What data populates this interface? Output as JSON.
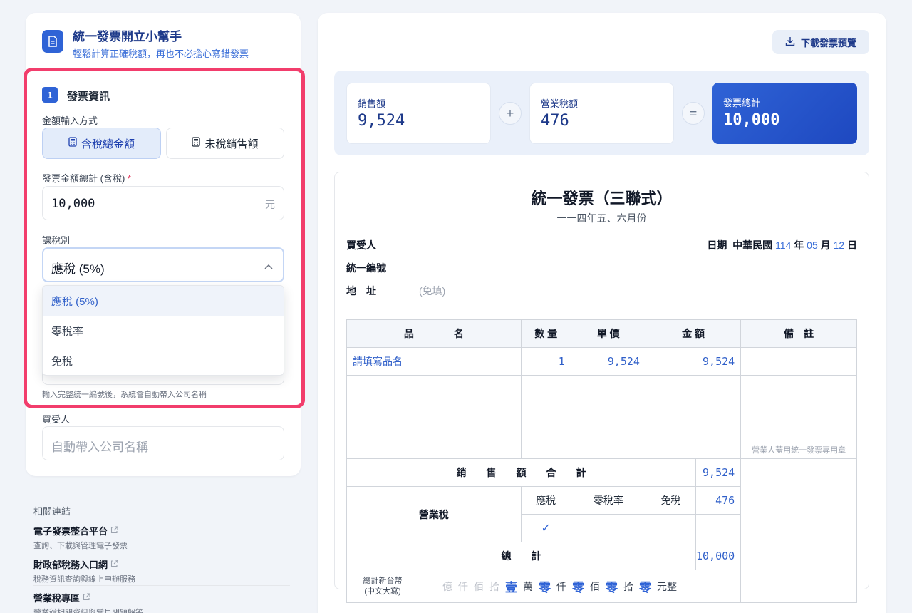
{
  "app": {
    "title": "統一發票開立小幫手",
    "subtitle": "輕鬆計算正確稅額，再也不必擔心寫錯發票"
  },
  "step1": {
    "number": "1",
    "title": "發票資訊",
    "mode_label": "金額輸入方式",
    "mode_taxed": "含稅總金額",
    "mode_untaxed": "未稅銷售額",
    "amount_label": "發票金額總計 (含稅)",
    "amount_required": "*",
    "amount_value": "10,000",
    "amount_unit": "元",
    "tax_type_label": "課稅別",
    "tax_type_selected": "應稅 (5%)",
    "tax_type_options": [
      "應稅 (5%)",
      "零稅率",
      "免稅"
    ],
    "hint": "輸入完整統一編號後，系統會自動帶入公司名稱",
    "buyer_label": "買受人",
    "buyer_placeholder": "自動帶入公司名稱"
  },
  "links": {
    "title": "相關連結",
    "items": [
      {
        "name": "電子發票整合平台",
        "desc": "查詢、下載與管理電子發票"
      },
      {
        "name": "財政部稅務入口網",
        "desc": "稅務資訊查詢與線上申辦服務"
      },
      {
        "name": "營業稅專區",
        "desc": "營業稅相關資訊與常見問題解答"
      }
    ]
  },
  "download_label": "下載發票預覽",
  "summary": {
    "sales_label": "銷售額",
    "sales_value": "9,524",
    "plus": "+",
    "tax_label": "營業稅額",
    "tax_value": "476",
    "equals": "=",
    "total_label": "發票總計",
    "total_value": "10,000"
  },
  "invoice": {
    "title": "統一發票（三聯式）",
    "period": "一一四年五、六月份",
    "buyer_label": "買受人",
    "taxid_label": "統一編號",
    "address_label": "地　址",
    "address_note": "(免填)",
    "date_label": "日期",
    "date_prefix": "中華民國",
    "year": "114",
    "year_unit": "年",
    "month": "05",
    "month_unit": "月",
    "day": "12",
    "day_unit": "日",
    "headers": {
      "name": "品　　　　名",
      "qty": "數 量",
      "price": "單 價",
      "amount": "金 額",
      "note": "備　註"
    },
    "row1": {
      "name": "請填寫品名",
      "qty": "1",
      "price": "9,524",
      "amount": "9,524"
    },
    "stamp_note": "營業人蓋用統一發票專用章",
    "sales_total_label": "銷　　售　　額　　合　　計",
    "sales_total_value": "9,524",
    "tax_row_label": "營業稅",
    "tax_col_taxable": "應稅",
    "tax_col_zero": "零稅率",
    "tax_col_exempt": "免稅",
    "tax_value": "476",
    "check": "✓",
    "grand_total_label": "總　　計",
    "grand_total_value": "10,000",
    "caps_label_line1": "總計新台幣",
    "caps_label_line2": "(中文大寫)",
    "caps": [
      {
        "digit": "億",
        "on": false
      },
      {
        "digit": "仟",
        "on": false
      },
      {
        "digit": "佰",
        "on": false
      },
      {
        "digit": "拾",
        "on": false
      },
      {
        "digit": "壹",
        "on": true
      },
      {
        "unit": "萬"
      },
      {
        "digit": "零",
        "on": true
      },
      {
        "unit": "仟"
      },
      {
        "digit": "零",
        "on": true
      },
      {
        "unit": "佰"
      },
      {
        "digit": "零",
        "on": true
      },
      {
        "unit": "拾"
      },
      {
        "digit": "零",
        "on": true
      },
      {
        "unit": "元整"
      }
    ]
  },
  "colors": {
    "accent": "#2f63d6",
    "highlight": "#f23d6c"
  }
}
